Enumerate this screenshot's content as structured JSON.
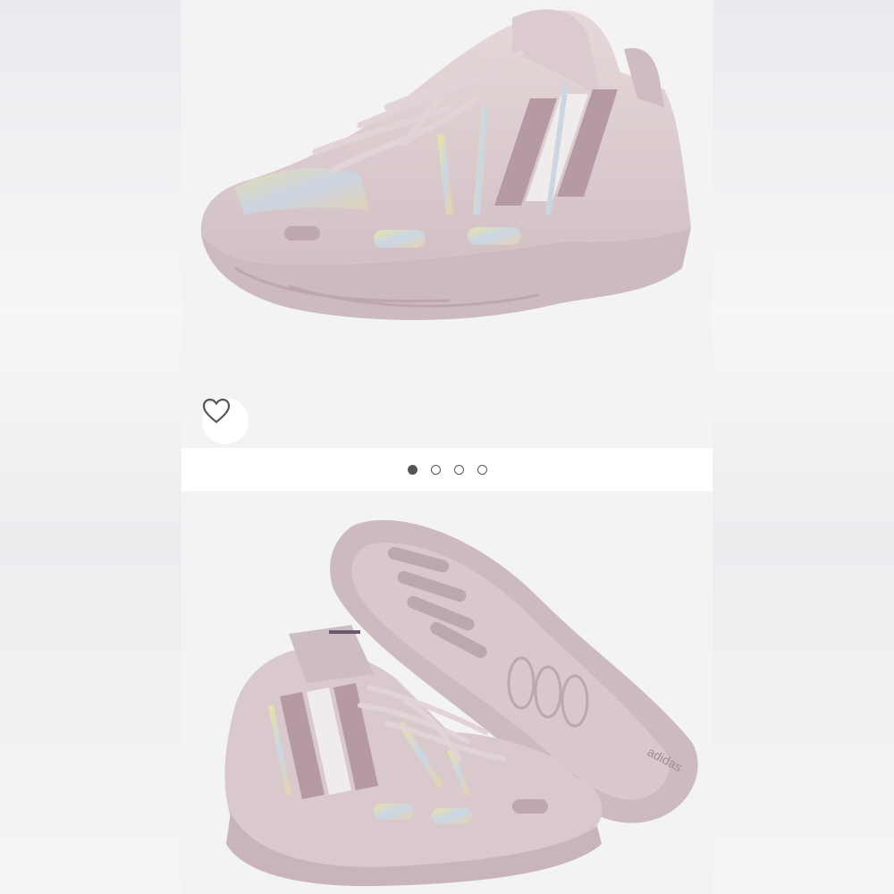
{
  "gallery": {
    "wishlist_icon": "heart-outline-icon",
    "pagination": {
      "total": 4,
      "active_index": 0
    },
    "bottom_image": {
      "brand_mark": "adidas"
    }
  },
  "colors": {
    "shoe_body": "#d9c9cc",
    "shoe_shadow": "#c4b0b5",
    "sole": "#cdbabe",
    "iridescent": "#d8d4a0",
    "photo_bg": "#f3f3f3",
    "dot_active": "#555555"
  }
}
